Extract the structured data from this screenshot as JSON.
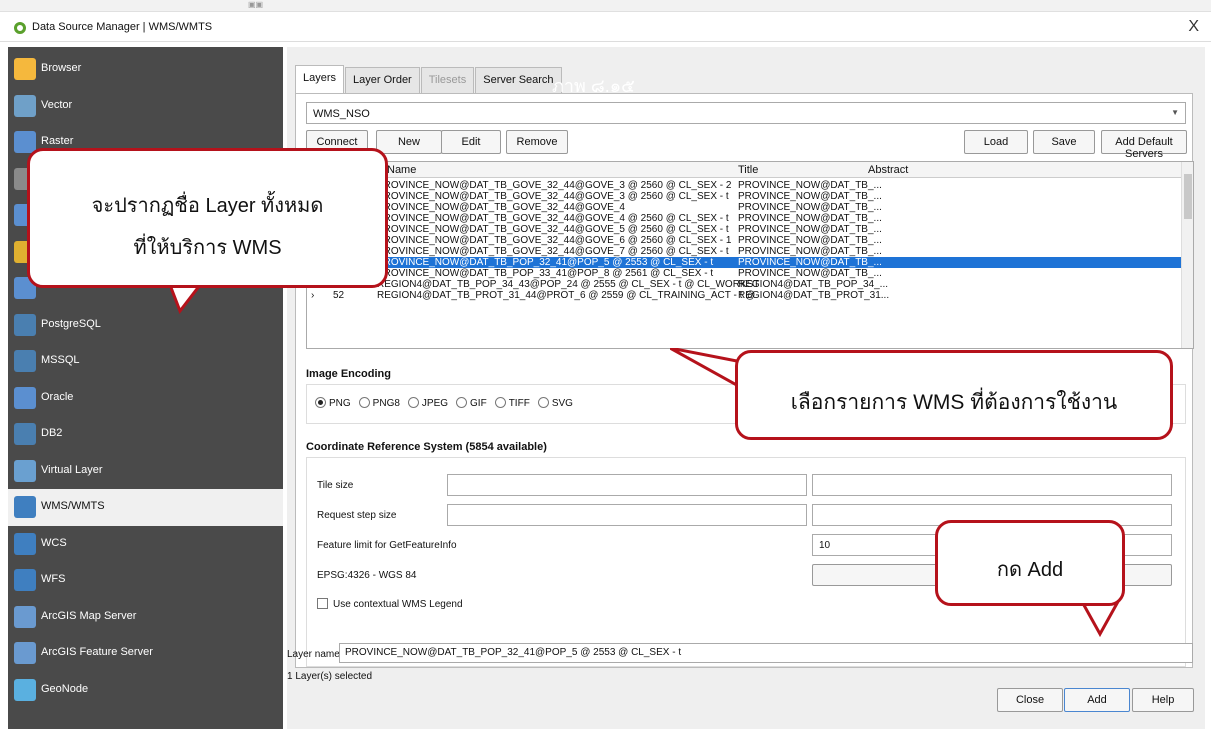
{
  "window": {
    "title": "Data Source Manager | WMS/WMTS",
    "close": "X",
    "top_marks": "▣▣"
  },
  "sidebar": {
    "items": [
      {
        "label": "Browser",
        "icon": "folder-icon",
        "color": "#f5b83d"
      },
      {
        "label": "Vector",
        "icon": "vector-icon",
        "color": "#6fa0c8"
      },
      {
        "label": "Raster",
        "icon": "raster-icon",
        "color": "#5b8fd0"
      },
      {
        "label": "",
        "icon": "mesh-icon",
        "color": "#8a8a8a"
      },
      {
        "label": "",
        "icon": "csv-icon",
        "color": "#5b8fd0"
      },
      {
        "label": "",
        "icon": "geopackage-icon",
        "color": "#e0b030"
      },
      {
        "label": "",
        "icon": "gps-icon",
        "color": "#5b8fd0"
      },
      {
        "label": "PostgreSQL",
        "icon": "postgresql-icon",
        "color": "#4a7fb0"
      },
      {
        "label": "MSSQL",
        "icon": "mssql-icon",
        "color": "#4a7fb0"
      },
      {
        "label": "Oracle",
        "icon": "oracle-icon",
        "color": "#5b8fd0"
      },
      {
        "label": "DB2",
        "icon": "db2-icon",
        "color": "#4a7fb0"
      },
      {
        "label": "Virtual Layer",
        "icon": "virtual-layer-icon",
        "color": "#6aa0d0"
      },
      {
        "label": "WMS/WMTS",
        "icon": "wms-icon",
        "color": "#3f7fc0"
      },
      {
        "label": "WCS",
        "icon": "wcs-icon",
        "color": "#3f7fc0"
      },
      {
        "label": "WFS",
        "icon": "wfs-icon",
        "color": "#3f7fc0"
      },
      {
        "label": "ArcGIS Map Server",
        "icon": "arcgis-map-icon",
        "color": "#6a9ad0"
      },
      {
        "label": "ArcGIS Feature Server",
        "icon": "arcgis-feature-icon",
        "color": "#6a9ad0"
      },
      {
        "label": "GeoNode",
        "icon": "geonode-icon",
        "color": "#5ab0e0"
      }
    ]
  },
  "tabs": [
    "Layers",
    "Layer Order",
    "Tilesets",
    "Server Search"
  ],
  "watermark": "ภาพ ๘.๑๕",
  "connection": {
    "selected": "WMS_NSO"
  },
  "buttons": {
    "connect": "Connect",
    "new": "New",
    "edit": "Edit",
    "remove": "Remove",
    "load": "Load",
    "save": "Save",
    "add_default": "Add Default Servers"
  },
  "table": {
    "headers": [
      "Name",
      "Title",
      "Abstract"
    ],
    "rows": [
      {
        "id": "",
        "name": "PROVINCE_NOW@DAT_TB_GOVE_32_44@GOVE_3 @ 2560 @ CL_SEX - 2",
        "title": "PROVINCE_NOW@DAT_TB_..."
      },
      {
        "id": "",
        "name": "PROVINCE_NOW@DAT_TB_GOVE_32_44@GOVE_3 @ 2560 @ CL_SEX - t",
        "title": "PROVINCE_NOW@DAT_TB_..."
      },
      {
        "id": "",
        "name": "PROVINCE_NOW@DAT_TB_GOVE_32_44@GOVE_4",
        "title": "PROVINCE_NOW@DAT_TB_..."
      },
      {
        "id": "",
        "name": "PROVINCE_NOW@DAT_TB_GOVE_32_44@GOVE_4 @ 2560 @ CL_SEX - t",
        "title": "PROVINCE_NOW@DAT_TB_..."
      },
      {
        "id": "",
        "name": "PROVINCE_NOW@DAT_TB_GOVE_32_44@GOVE_5 @ 2560 @ CL_SEX - t",
        "title": "PROVINCE_NOW@DAT_TB_..."
      },
      {
        "id": "",
        "name": "PROVINCE_NOW@DAT_TB_GOVE_32_44@GOVE_6 @ 2560 @ CL_SEX - 1",
        "title": "PROVINCE_NOW@DAT_TB_..."
      },
      {
        "id": "",
        "name": "PROVINCE_NOW@DAT_TB_GOVE_32_44@GOVE_7 @ 2560 @ CL_SEX - t",
        "title": "PROVINCE_NOW@DAT_TB_..."
      },
      {
        "id": "",
        "name": "PROVINCE_NOW@DAT_TB_POP_32_41@POP_5 @ 2553 @ CL_SEX - t",
        "title": "PROVINCE_NOW@DAT_TB_..."
      },
      {
        "id": "48",
        "name": "PROVINCE_NOW@DAT_TB_POP_33_41@POP_8 @ 2561 @ CL_SEX - t",
        "title": "PROVINCE_NOW@DAT_TB_..."
      },
      {
        "id": "50",
        "name": "REGION4@DAT_TB_POP_34_43@POP_24 @ 2555 @ CL_SEX - t @ CL_WORKST",
        "title": "REGION4@DAT_TB_POP_34_..."
      },
      {
        "id": "52",
        "name": "REGION4@DAT_TB_PROT_31_44@PROT_6 @ 2559 @ CL_TRAINING_ACT - t @",
        "title": "REGION4@DAT_TB_PROT_31..."
      }
    ],
    "selected_index": 7
  },
  "image_encoding": {
    "label": "Image Encoding",
    "options": [
      "PNG",
      "PNG8",
      "JPEG",
      "GIF",
      "TIFF",
      "SVG"
    ],
    "selected": "PNG"
  },
  "crs": {
    "label": "Coordinate Reference System (5854 available)",
    "current": "EPSG:4326 - WGS 84"
  },
  "fields": {
    "tile_size": "Tile size",
    "request_step": "Request step size",
    "feature_limit": "Feature limit for GetFeatureInfo",
    "feature_limit_value": "10",
    "contextual_legend": "Use contextual WMS Legend"
  },
  "bottom": {
    "layer_name_label": "Layer name",
    "layer_name_value": "PROVINCE_NOW@DAT_TB_POP_32_41@POP_5 @ 2553 @ CL_SEX - t",
    "status": "1 Layer(s) selected",
    "close": "Close",
    "add": "Add",
    "help": "Help"
  },
  "callouts": {
    "c1_line1": "จะปรากฏชื่อ Layer ทั้งหมด",
    "c1_line2": "ที่ให้บริการ WMS",
    "c2": "เลือกรายการ WMS ที่ต้องการใช้งาน",
    "c3": "กด Add"
  }
}
